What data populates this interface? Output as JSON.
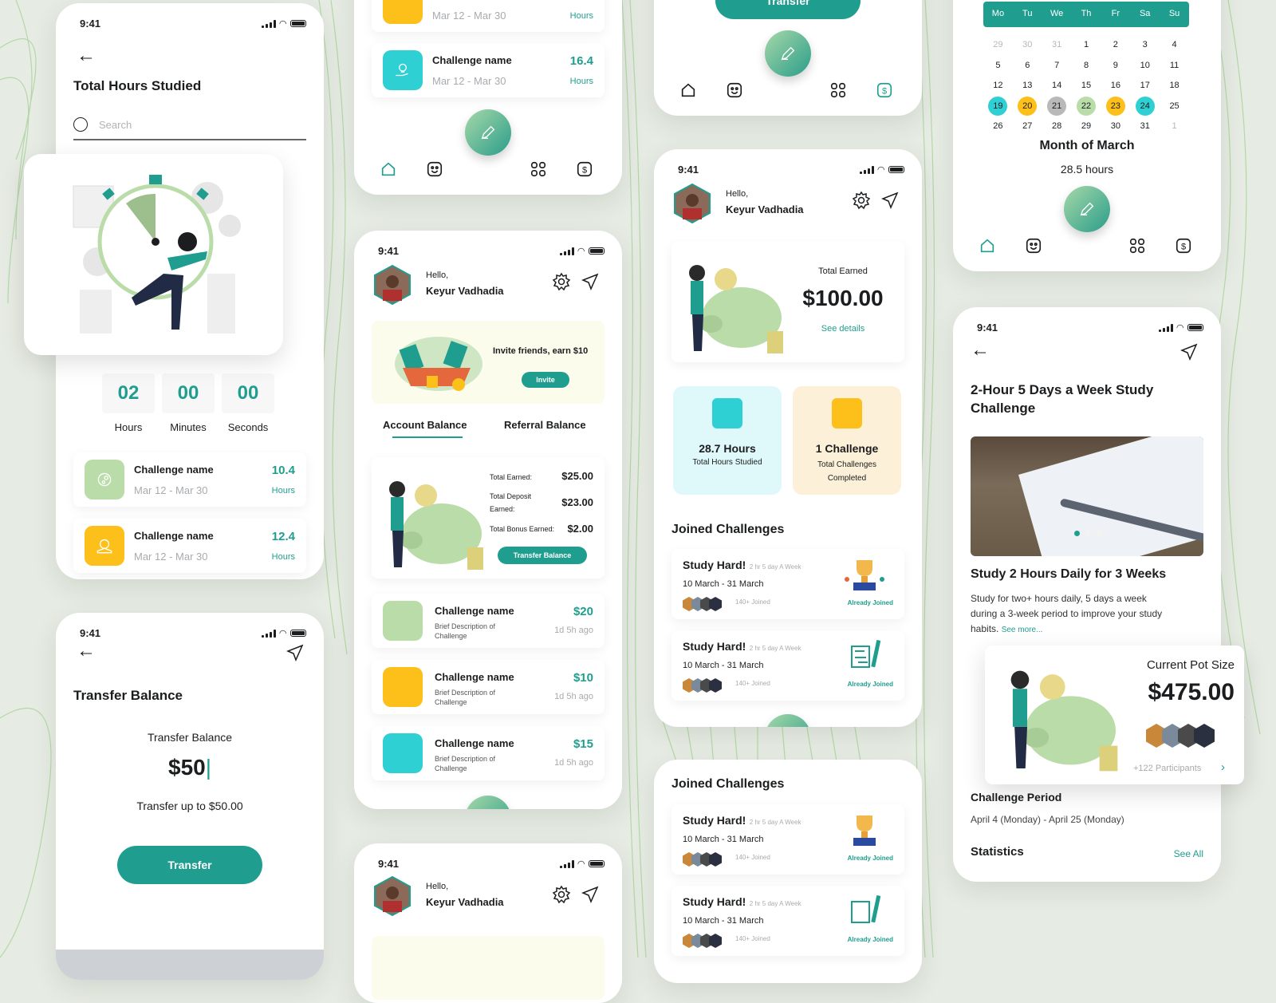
{
  "status_time": "9:41",
  "colors": {
    "accent": "#1f9e8f",
    "green_tile": "#b9dca8",
    "yellow_tile": "#fdbf19",
    "cyan_tile": "#2fd0d3",
    "background": "#e6ebe3"
  },
  "user": {
    "greeting": "Hello,",
    "name": "Keyur Vadhadia"
  },
  "total_hours_screen": {
    "title": "Total Hours Studied",
    "search_placeholder": "Search",
    "timer": {
      "hours": "02",
      "minutes": "00",
      "seconds": "00",
      "hours_label": "Hours",
      "minutes_label": "Minutes",
      "seconds_label": "Seconds"
    },
    "challenges": [
      {
        "name": "Challenge name",
        "dates": "Mar 12 - Mar 30",
        "value": "10.4",
        "unit": "Hours",
        "icon": "brain-gear-icon"
      },
      {
        "name": "Challenge name",
        "dates": "Mar 12 - Mar 30",
        "value": "12.4",
        "unit": "Hours",
        "icon": "book-idea-icon"
      }
    ]
  },
  "hours_list_tail": {
    "items": [
      {
        "dates": "Mar 12 - Mar 30",
        "unit": "Hours",
        "icon": "book-idea-icon"
      },
      {
        "name": "Challenge name",
        "dates": "Mar 12 - Mar 30",
        "value": "16.4",
        "unit": "Hours",
        "icon": "lightbulb-hand-icon"
      }
    ]
  },
  "nav": {
    "items": [
      "home",
      "smiley",
      "grid",
      "dollar"
    ]
  },
  "wallet_screen": {
    "invite_text": "Invite friends, earn $10",
    "invite_button": "Invite",
    "tabs": [
      "Account Balance",
      "Referral Balance"
    ],
    "active_tab": 0,
    "total_earned_label": "Total Earned:",
    "total_earned": "$25.00",
    "deposit_label_1": "Total Deposit",
    "deposit_label_2": "Earned:",
    "deposit": "$23.00",
    "bonus_label": "Total Bonus Earned:",
    "bonus": "$2.00",
    "transfer_button": "Transfer Balance",
    "challenges": [
      {
        "name": "Challenge name",
        "desc_1": "Brief Description of",
        "desc_2": "Challenge",
        "amount": "$20",
        "time": "1d 5h ago"
      },
      {
        "name": "Challenge name",
        "desc_1": "Brief Description of",
        "desc_2": "Challenge",
        "amount": "$10",
        "time": "1d 5h ago"
      },
      {
        "name": "Challenge name",
        "desc_1": "Brief Description of",
        "desc_2": "Challenge",
        "amount": "$15",
        "time": "1d 5h ago"
      }
    ]
  },
  "transfer_tail": {
    "button": "Transfer"
  },
  "transfer_screen": {
    "title": "Transfer Balance",
    "label": "Transfer Balance",
    "amount": "$50",
    "limit": "Transfer up to $50.00",
    "button": "Transfer"
  },
  "dashboard_screen": {
    "total_earned_label": "Total Earned",
    "total_earned": "$100.00",
    "see_details": "See details",
    "stats": [
      {
        "value": "28.7 Hours",
        "label": "Total Hours Studied"
      },
      {
        "value": "1 Challenge",
        "label_1": "Total Challenges",
        "label_2": "Completed"
      }
    ],
    "joined_title": "Joined Challenges",
    "joined": [
      {
        "title": "Study Hard!",
        "freq": "2 hr 5 day A Week",
        "dates": "10 March - 31 March",
        "joined": "140+ Joined",
        "status": "Already Joined"
      },
      {
        "title": "Study Hard!",
        "freq": "2 hr 5 day A Week",
        "dates": "10 March - 31 March",
        "joined": "140+ Joined",
        "status": "Already Joined"
      }
    ]
  },
  "joined_screen": {
    "title": "Joined Challenges",
    "joined": [
      {
        "title": "Study Hard!",
        "freq": "2 hr 5 day A Week",
        "dates": "10 March - 31 March",
        "joined": "140+ Joined",
        "status": "Already Joined"
      },
      {
        "title": "Study Hard!",
        "freq": "2 hr 5 day A Week",
        "dates": "10 March - 31 March",
        "joined": "140+ Joined",
        "status": "Already Joined"
      }
    ]
  },
  "calendar_screen": {
    "weekdays": [
      "Mo",
      "Tu",
      "We",
      "Th",
      "Fr",
      "Sa",
      "Su"
    ],
    "weeks": [
      [
        "29",
        "30",
        "31",
        "1",
        "2",
        "3",
        "4"
      ],
      [
        "5",
        "6",
        "7",
        "8",
        "9",
        "10",
        "11"
      ],
      [
        "12",
        "13",
        "14",
        "15",
        "16",
        "17",
        "18"
      ],
      [
        "19",
        "20",
        "21",
        "22",
        "23",
        "24",
        "25"
      ],
      [
        "26",
        "27",
        "28",
        "29",
        "30",
        "31",
        "1"
      ]
    ],
    "highlights": {
      "19": "#2fd0d3",
      "20": "#fdbf19",
      "21": "#b9b9b9",
      "22": "#b9dca8",
      "23": "#fdbf19",
      "24": "#2fd0d3"
    },
    "month_title": "Month of March",
    "month_hours": "28.5 hours"
  },
  "challenge_detail_screen": {
    "title_1": "2-Hour 5 Days a Week Study",
    "title_2": "Challenge",
    "carousel_index": 0,
    "carousel_count": 3,
    "headline": "Study 2 Hours Daily for 3 Weeks",
    "desc_1": "Study for two+ hours daily, 5 days a week",
    "desc_2": "during a 3-week period to improve your study",
    "desc_3": "habits.",
    "see_more": "See more...",
    "pot_label": "Current Pot Size",
    "pot_value": "$475.00",
    "participants": "+122 Participants",
    "period_title": "Challenge Period",
    "period": "April 4 (Monday) - April 25 (Monday)",
    "stats_title": "Statistics",
    "see_all": "See All"
  }
}
